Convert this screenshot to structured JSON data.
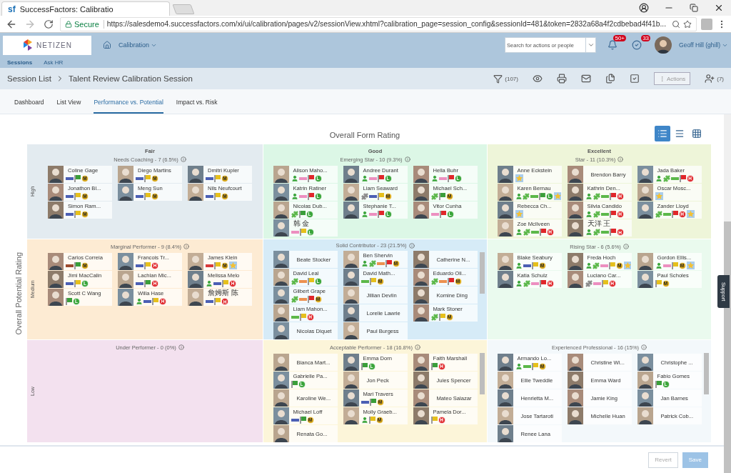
{
  "browser": {
    "tab_icon": "sf",
    "tab_title": "SuccessFactors: Calibratio",
    "secure_label": "Secure",
    "url": "https://salesdemo4.successfactors.com/xi/ui/calibration/pages/v2/sessionView.xhtml?calibration_page=session_config&sessionId=481&token=2832a68a4f2cdbebad4f41b..."
  },
  "header": {
    "logo": "NETIZEN",
    "nav_menu": "Calibration",
    "search": {
      "placeholder": "Search for actions or people"
    },
    "notification_count": "50+",
    "todo_count": "33",
    "user": "Geoff Hill (ghill)"
  },
  "subnav": [
    "Sessions",
    "Ask HR"
  ],
  "session_bar": {
    "breadcrumb": [
      "Session List",
      "Talent Review Calibration Session"
    ],
    "filter_count": "(107)",
    "actions": "Actions",
    "participant_count": "(7)"
  },
  "tabs": [
    {
      "label": "Dashboard",
      "selected": false
    },
    {
      "label": "List View",
      "selected": false
    },
    {
      "label": "Performance vs. Potential",
      "selected": true
    },
    {
      "label": "Impact vs. Risk",
      "selected": false
    }
  ],
  "matrix": {
    "title": "Overall Form Rating",
    "y_axis": "Overall Potential Rating",
    "views": [
      {
        "kind": "detail",
        "selected": true
      },
      {
        "kind": "list",
        "selected": false
      },
      {
        "kind": "grid",
        "selected": false
      }
    ],
    "rows": [
      {
        "label": "High",
        "cells": [
          {
            "heading": "Fair",
            "title": "Needs Coaching - 7 (6.5%)",
            "color": "#e3ebf0",
            "people": [
              {
                "name": "Coline Gage",
                "badges": [
                  {
                    "kind": "bar",
                    "color": "#4b5fb4"
                  },
                  {
                    "kind": "flag",
                    "color": "#3a9e3a"
                  },
                  {
                    "kind": "rating",
                    "text": "M",
                    "color": "#d9a91a"
                  }
                ]
              },
              {
                "name": "Diego Martins",
                "badges": [
                  {
                    "kind": "bar",
                    "color": "#4b5fb4"
                  },
                  {
                    "kind": "flag",
                    "color": "#e6c01c"
                  },
                  {
                    "kind": "rating",
                    "text": "M",
                    "color": "#d9a91a"
                  }
                ]
              },
              {
                "name": "Dmitri Kupler",
                "badges": [
                  {
                    "kind": "bar",
                    "color": "#4b5fb4"
                  },
                  {
                    "kind": "flag",
                    "color": "#e6c01c"
                  },
                  {
                    "kind": "rating",
                    "text": "M",
                    "color": "#d9a91a"
                  }
                ]
              },
              {
                "name": "Jonathon Bl...",
                "badges": [
                  {
                    "kind": "bar",
                    "color": "#4b5fb4"
                  },
                  {
                    "kind": "flag",
                    "color": "#e6c01c"
                  },
                  {
                    "kind": "rating",
                    "text": "M",
                    "color": "#d9a91a"
                  }
                ]
              },
              {
                "name": "Meng Sun",
                "badges": [
                  {
                    "kind": "bar",
                    "color": "#4b5fb4"
                  },
                  {
                    "kind": "flag",
                    "color": "#e6c01c"
                  },
                  {
                    "kind": "rating",
                    "text": "M",
                    "color": "#d9a91a"
                  }
                ]
              },
              {
                "name": "Nils Neufcourt",
                "badges": [
                  {
                    "kind": "bar",
                    "color": "#4b5fb4"
                  },
                  {
                    "kind": "flag",
                    "color": "#e6c01c"
                  },
                  {
                    "kind": "rating",
                    "text": "M",
                    "color": "#d9a91a"
                  }
                ]
              },
              {
                "name": "Simon Ram...",
                "badges": [
                  {
                    "kind": "bar",
                    "color": "#4b5fb4"
                  },
                  {
                    "kind": "flag",
                    "color": "#e6c01c"
                  },
                  {
                    "kind": "rating",
                    "text": "M",
                    "color": "#d9a91a"
                  }
                ]
              }
            ]
          },
          {
            "heading": "Good",
            "title": "Emerging Star - 10 (9.3%)",
            "color": "#dcf7e6",
            "people": [
              {
                "name": "Alison Maho...",
                "badges": [
                  {
                    "kind": "person"
                  },
                  {
                    "kind": "bar",
                    "color": "#ec8fc0"
                  },
                  {
                    "kind": "flag",
                    "color": "#e0262a"
                  },
                  {
                    "kind": "rating",
                    "text": "L",
                    "color": "#3aa53a"
                  }
                ]
              },
              {
                "name": "Andree Durant",
                "badges": [
                  {
                    "kind": "person"
                  },
                  {
                    "kind": "bar",
                    "color": "#ec8fc0"
                  },
                  {
                    "kind": "flag",
                    "color": "#e0262a"
                  },
                  {
                    "kind": "rating",
                    "text": "L",
                    "color": "#3aa53a"
                  }
                ]
              },
              {
                "name": "Hella Buhr",
                "badges": [
                  {
                    "kind": "person"
                  },
                  {
                    "kind": "bar",
                    "color": "#ec8fc0"
                  },
                  {
                    "kind": "flag",
                    "color": "#e0262a"
                  },
                  {
                    "kind": "rating",
                    "text": "L",
                    "color": "#3aa53a"
                  }
                ]
              },
              {
                "name": "Katrin Ratiner",
                "badges": [
                  {
                    "kind": "person"
                  },
                  {
                    "kind": "bar",
                    "color": "#ec8fc0"
                  },
                  {
                    "kind": "flag",
                    "color": "#e0262a"
                  },
                  {
                    "kind": "rating",
                    "text": "L",
                    "color": "#3aa53a"
                  }
                ]
              },
              {
                "name": "Liam Seaward",
                "badges": [
                  {
                    "kind": "puzzle",
                    "color": "#8c8c8c"
                  },
                  {
                    "kind": "bar",
                    "color": "#4b5fb4"
                  },
                  {
                    "kind": "flag",
                    "color": "#e6c01c"
                  },
                  {
                    "kind": "rating",
                    "text": "M",
                    "color": "#d9a91a"
                  }
                ]
              },
              {
                "name": "Michael Sch...",
                "badges": [
                  {
                    "kind": "puzzle",
                    "color": "#5cb84a"
                  },
                  {
                    "kind": "flag",
                    "color": "#3a9e3a"
                  },
                  {
                    "kind": "rating",
                    "text": "M",
                    "color": "#d9a91a"
                  }
                ]
              },
              {
                "name": "Nicolas Dub...",
                "badges": [
                  {
                    "kind": "puzzle",
                    "color": "#5cb84a"
                  },
                  {
                    "kind": "flag",
                    "color": "#3a9e3a"
                  },
                  {
                    "kind": "rating",
                    "text": "L",
                    "color": "#3aa53a"
                  }
                ]
              },
              {
                "name": "Stephanie T...",
                "badges": [
                  {
                    "kind": "person"
                  },
                  {
                    "kind": "bar",
                    "color": "#ec8fc0"
                  },
                  {
                    "kind": "flag",
                    "color": "#e0262a"
                  },
                  {
                    "kind": "rating",
                    "text": "L",
                    "color": "#3aa53a"
                  }
                ]
              },
              {
                "name": "Vitor Cunha",
                "badges": [
                  {
                    "kind": "bar",
                    "color": "#ec8fc0"
                  },
                  {
                    "kind": "flag",
                    "color": "#e0262a"
                  },
                  {
                    "kind": "rating",
                    "text": "L",
                    "color": "#3aa53a"
                  }
                ]
              },
              {
                "name": "韩 金",
                "badges": [
                  {
                    "kind": "bar",
                    "color": "#ec8fc0"
                  },
                  {
                    "kind": "flag",
                    "color": "#e6c01c"
                  },
                  {
                    "kind": "rating",
                    "text": "L",
                    "color": "#3aa53a"
                  }
                ]
              }
            ]
          },
          {
            "heading": "Excellent",
            "title": "Star - 11 (10.3%)",
            "color": "#eef5d9",
            "people": [
              {
                "name": "Anne Eckstein",
                "badges": [
                  {
                    "kind": "star"
                  }
                ]
              },
              {
                "name": "Brendon Barry"
              },
              {
                "name": "Jada Baker",
                "badges": [
                  {
                    "kind": "person"
                  },
                  {
                    "kind": "puzzle",
                    "color": "#5cb84a"
                  },
                  {
                    "kind": "bar",
                    "color": "#5cb84a"
                  },
                  {
                    "kind": "flag",
                    "color": "#e0262a"
                  },
                  {
                    "kind": "rating",
                    "text": "H",
                    "color": "#e0262a"
                  }
                ]
              },
              {
                "name": "Karen Bernau",
                "badges": [
                  {
                    "kind": "person"
                  },
                  {
                    "kind": "puzzle",
                    "color": "#5cb84a"
                  },
                  {
                    "kind": "bar",
                    "color": "#5cb84a"
                  },
                  {
                    "kind": "flag",
                    "color": "#3a9e3a"
                  },
                  {
                    "kind": "rating",
                    "text": "L",
                    "color": "#3aa53a"
                  },
                  {
                    "kind": "star"
                  }
                ]
              },
              {
                "name": "Kathrin Den...",
                "badges": [
                  {
                    "kind": "person"
                  },
                  {
                    "kind": "puzzle",
                    "color": "#5cb84a"
                  },
                  {
                    "kind": "bar",
                    "color": "#5cb84a"
                  },
                  {
                    "kind": "flag",
                    "color": "#e0262a"
                  },
                  {
                    "kind": "rating",
                    "text": "H",
                    "color": "#e0262a"
                  }
                ]
              },
              {
                "name": "Oscar Mosc...",
                "badges": [
                  {
                    "kind": "star"
                  }
                ]
              },
              {
                "name": "Rebecca Ch...",
                "badges": [
                  {
                    "kind": "star"
                  }
                ]
              },
              {
                "name": "Silvia Candido",
                "badges": [
                  {
                    "kind": "person"
                  },
                  {
                    "kind": "puzzle",
                    "color": "#5cb84a"
                  },
                  {
                    "kind": "bar",
                    "color": "#5cb84a"
                  },
                  {
                    "kind": "flag",
                    "color": "#e0262a"
                  },
                  {
                    "kind": "rating",
                    "text": "H",
                    "color": "#e0262a"
                  }
                ]
              },
              {
                "name": "Zander Lloyd",
                "badges": [
                  {
                    "kind": "puzzle",
                    "color": "#5cb84a"
                  },
                  {
                    "kind": "bar",
                    "color": "#5cb84a"
                  },
                  {
                    "kind": "flag",
                    "color": "#e0262a"
                  },
                  {
                    "kind": "rating",
                    "text": "H",
                    "color": "#e0262a"
                  },
                  {
                    "kind": "star"
                  }
                ]
              },
              {
                "name": "Zoe McIlveen",
                "badges": [
                  {
                    "kind": "person"
                  },
                  {
                    "kind": "puzzle",
                    "color": "#5cb84a"
                  },
                  {
                    "kind": "bar",
                    "color": "#5cb84a"
                  },
                  {
                    "kind": "flag",
                    "color": "#e0262a"
                  },
                  {
                    "kind": "rating",
                    "text": "H",
                    "color": "#e0262a"
                  }
                ]
              },
              {
                "name": "天洋 王",
                "badges": [
                  {
                    "kind": "person"
                  },
                  {
                    "kind": "puzzle",
                    "color": "#5cb84a"
                  },
                  {
                    "kind": "bar",
                    "color": "#5cb84a"
                  },
                  {
                    "kind": "flag",
                    "color": "#e0262a"
                  },
                  {
                    "kind": "rating",
                    "text": "H",
                    "color": "#e0262a"
                  }
                ]
              }
            ]
          }
        ]
      },
      {
        "label": "Medium",
        "cells": [
          {
            "title": "Marginal Performer - 9 (8.4%)",
            "color": "#fdebd3",
            "people": [
              {
                "name": "Carlos Correia",
                "badges": [
                  {
                    "kind": "bar",
                    "color": "#9c4a2e"
                  },
                  {
                    "kind": "flag",
                    "color": "#3a9e3a"
                  },
                  {
                    "kind": "rating",
                    "text": "M",
                    "color": "#d9a91a"
                  }
                ]
              },
              {
                "name": "Francois Tr...",
                "badges": [
                  {
                    "kind": "bar",
                    "color": "#4b5fb4"
                  },
                  {
                    "kind": "flag",
                    "color": "#e6c01c"
                  },
                  {
                    "kind": "rating",
                    "text": "H",
                    "color": "#e0262a"
                  }
                ]
              },
              {
                "name": "James Klein",
                "badges": [
                  {
                    "kind": "bar",
                    "color": "#d73a3a"
                  },
                  {
                    "kind": "flag",
                    "color": "#e6c01c"
                  },
                  {
                    "kind": "rating",
                    "text": "M",
                    "color": "#d9a91a"
                  },
                  {
                    "kind": "star"
                  }
                ]
              },
              {
                "name": "Jimi MacCalin",
                "badges": [
                  {
                    "kind": "bar",
                    "color": "#4b5fb4"
                  },
                  {
                    "kind": "flag",
                    "color": "#e6c01c"
                  },
                  {
                    "kind": "rating",
                    "text": "L",
                    "color": "#3aa53a"
                  }
                ]
              },
              {
                "name": "Lachlan Mic...",
                "badges": [
                  {
                    "kind": "bar",
                    "color": "#4b5fb4"
                  },
                  {
                    "kind": "flag",
                    "color": "#3a9e3a"
                  },
                  {
                    "kind": "rating",
                    "text": "H",
                    "color": "#e0262a"
                  }
                ]
              },
              {
                "name": "Melissa Melo",
                "badges": [
                  {
                    "kind": "person"
                  },
                  {
                    "kind": "bar",
                    "color": "#4b5fb4"
                  },
                  {
                    "kind": "flag",
                    "color": "#e6c01c"
                  },
                  {
                    "kind": "rating",
                    "text": "H",
                    "color": "#e0262a"
                  }
                ]
              },
              {
                "name": "Scott C Wang",
                "badges": [
                  {
                    "kind": "flag",
                    "color": "#3a9e3a"
                  },
                  {
                    "kind": "rating",
                    "text": "L",
                    "color": "#3aa53a"
                  }
                ]
              },
              {
                "name": "Willa Hase",
                "badges": [
                  {
                    "kind": "person"
                  },
                  {
                    "kind": "bar",
                    "color": "#4b5fb4"
                  },
                  {
                    "kind": "flag",
                    "color": "#e6c01c"
                  },
                  {
                    "kind": "rating",
                    "text": "H",
                    "color": "#e0262a"
                  }
                ]
              },
              {
                "name": "詹姆斯 陈",
                "badges": [
                  {
                    "kind": "bar",
                    "color": "#4b5fb4"
                  },
                  {
                    "kind": "flag",
                    "color": "#e6c01c"
                  },
                  {
                    "kind": "rating",
                    "text": "H",
                    "color": "#e0262a"
                  }
                ]
              }
            ]
          },
          {
            "title": "Solid Contributor - 23 (21.5%)",
            "color": "#d6ebf7",
            "people": [
              {
                "name": "Beate Stocker"
              },
              {
                "name": "Ben Shervin",
                "badges": [
                  {
                    "kind": "person"
                  },
                  {
                    "kind": "puzzle",
                    "color": "#5cb84a"
                  },
                  {
                    "kind": "bar",
                    "color": "#ec9150"
                  },
                  {
                    "kind": "flag",
                    "color": "#e0262a"
                  },
                  {
                    "kind": "rating",
                    "text": "M",
                    "color": "#d9a91a"
                  }
                ]
              },
              {
                "name": "Catherine N..."
              },
              {
                "name": "David Leal",
                "badges": [
                  {
                    "kind": "puzzle",
                    "color": "#5cb84a"
                  },
                  {
                    "kind": "bar",
                    "color": "#ec9150"
                  },
                  {
                    "kind": "flag",
                    "color": "#e6c01c"
                  },
                  {
                    "kind": "rating",
                    "text": "L",
                    "color": "#3aa53a"
                  }
                ]
              },
              {
                "name": "David Math...",
                "badges": [
                  {
                    "kind": "bar",
                    "color": "#5cb84a"
                  },
                  {
                    "kind": "flag",
                    "color": "#e6c01c"
                  },
                  {
                    "kind": "rating",
                    "text": "M",
                    "color": "#d9a91a"
                  }
                ]
              },
              {
                "name": "Eduardo Oli...",
                "badges": [
                  {
                    "kind": "puzzle",
                    "color": "#5cb84a"
                  },
                  {
                    "kind": "bar",
                    "color": "#ec9150"
                  },
                  {
                    "kind": "flag",
                    "color": "#e0262a"
                  },
                  {
                    "kind": "rating",
                    "text": "M",
                    "color": "#d9a91a"
                  }
                ]
              },
              {
                "name": "Gilbert Grape",
                "badges": [
                  {
                    "kind": "puzzle",
                    "color": "#5cb84a"
                  },
                  {
                    "kind": "bar",
                    "color": "#ec9150"
                  },
                  {
                    "kind": "flag",
                    "color": "#e0262a"
                  },
                  {
                    "kind": "rating",
                    "text": "M",
                    "color": "#d9a91a"
                  }
                ]
              },
              {
                "name": "Jillian Devlin"
              },
              {
                "name": "Komine Ding"
              },
              {
                "name": "Liam Mahon...",
                "badges": [
                  {
                    "kind": "bar",
                    "color": "#5cb84a"
                  },
                  {
                    "kind": "flag",
                    "color": "#e6c01c"
                  },
                  {
                    "kind": "rating",
                    "text": "H",
                    "color": "#e0262a"
                  }
                ]
              },
              {
                "name": "Lorelie Lawrie"
              },
              {
                "name": "Mark Stoner",
                "badges": [
                  {
                    "kind": "puzzle",
                    "color": "#5cb84a"
                  },
                  {
                    "kind": "flag",
                    "color": "#e6c01c"
                  },
                  {
                    "kind": "rating",
                    "text": "M",
                    "color": "#d9a91a"
                  }
                ]
              },
              {
                "name": "Nicolas Diquet"
              },
              {
                "name": "Paul Burgess"
              }
            ]
          },
          {
            "title": "Rising Star - 6 (5.6%)",
            "color": "#eafaee",
            "people": [
              {
                "name": "Blake Seabury",
                "badges": [
                  {
                    "kind": "person"
                  },
                  {
                    "kind": "bar",
                    "color": "#4b5fb4"
                  },
                  {
                    "kind": "flag",
                    "color": "#e6c01c"
                  },
                  {
                    "kind": "rating",
                    "text": "M",
                    "color": "#d9a91a"
                  }
                ]
              },
              {
                "name": "Freda Hoch",
                "badges": [
                  {
                    "kind": "person"
                  },
                  {
                    "kind": "puzzle",
                    "color": "#5cb84a"
                  },
                  {
                    "kind": "bar",
                    "color": "#ec8fc0"
                  },
                  {
                    "kind": "flag",
                    "color": "#e6c01c"
                  },
                  {
                    "kind": "rating",
                    "text": "M",
                    "color": "#d9a91a"
                  },
                  {
                    "kind": "star"
                  }
                ]
              },
              {
                "name": "Gordon Ellis...",
                "badges": [
                  {
                    "kind": "person"
                  },
                  {
                    "kind": "bar",
                    "color": "#ec8fc0"
                  },
                  {
                    "kind": "flag",
                    "color": "#e6c01c"
                  },
                  {
                    "kind": "rating",
                    "text": "M",
                    "color": "#d9a91a"
                  },
                  {
                    "kind": "star"
                  }
                ]
              },
              {
                "name": "Katia Schulz",
                "badges": [
                  {
                    "kind": "person"
                  },
                  {
                    "kind": "puzzle",
                    "color": "#5cb84a"
                  },
                  {
                    "kind": "bar",
                    "color": "#ec8fc0"
                  },
                  {
                    "kind": "flag",
                    "color": "#e0262a"
                  },
                  {
                    "kind": "rating",
                    "text": "H",
                    "color": "#e0262a"
                  }
                ]
              },
              {
                "name": "Luciano Car...",
                "badges": [
                  {
                    "kind": "puzzle",
                    "color": "#8c8c8c"
                  },
                  {
                    "kind": "bar",
                    "color": "#ec8fc0"
                  },
                  {
                    "kind": "flag",
                    "color": "#e6c01c"
                  },
                  {
                    "kind": "rating",
                    "text": "H",
                    "color": "#e0262a"
                  }
                ]
              },
              {
                "name": "Paul Scholes",
                "badges": [
                  {
                    "kind": "flag",
                    "color": "#e6c01c"
                  },
                  {
                    "kind": "rating",
                    "text": "M",
                    "color": "#d9a91a"
                  }
                ]
              }
            ]
          }
        ]
      },
      {
        "label": "Low",
        "cells": [
          {
            "title": "Under Performer - 0 (0%)",
            "color": "#f3e1ef"
          },
          {
            "title": "Acceptable Performer - 18 (16.8%)",
            "color": "#fcf5d9",
            "people": [
              {
                "name": "Bianca Mart..."
              },
              {
                "name": "Emma Dorn",
                "badges": [
                  {
                    "kind": "flag",
                    "color": "#3a9e3a"
                  },
                  {
                    "kind": "rating",
                    "text": "L",
                    "color": "#3aa53a"
                  }
                ]
              },
              {
                "name": "Faith Marshall",
                "badges": [
                  {
                    "kind": "flag",
                    "color": "#3a9e3a"
                  },
                  {
                    "kind": "rating",
                    "text": "H",
                    "color": "#e0262a"
                  }
                ]
              },
              {
                "name": "Gabrielle Pa...",
                "badges": [
                  {
                    "kind": "flag",
                    "color": "#3a9e3a"
                  },
                  {
                    "kind": "rating",
                    "text": "L",
                    "color": "#3aa53a"
                  }
                ]
              },
              {
                "name": "Jon Peck"
              },
              {
                "name": "Jules Spencer"
              },
              {
                "name": "Karoline We..."
              },
              {
                "name": "Mari Travers",
                "badges": [
                  {
                    "kind": "bar",
                    "color": "#4b5fb4"
                  },
                  {
                    "kind": "flag",
                    "color": "#3a9e3a"
                  },
                  {
                    "kind": "rating",
                    "text": "M",
                    "color": "#d9a91a"
                  }
                ]
              },
              {
                "name": "Mateo Salazar"
              },
              {
                "name": "Michael Loff",
                "badges": [
                  {
                    "kind": "bar",
                    "color": "#4b5fb4"
                  },
                  {
                    "kind": "flag",
                    "color": "#3a9e3a"
                  },
                  {
                    "kind": "rating",
                    "text": "M",
                    "color": "#d9a91a"
                  }
                ]
              },
              {
                "name": "Molly Graeb...",
                "badges": [
                  {
                    "kind": "person"
                  },
                  {
                    "kind": "flag",
                    "color": "#e6c01c"
                  },
                  {
                    "kind": "rating",
                    "text": "M",
                    "color": "#d9a91a"
                  }
                ]
              },
              {
                "name": "Pamela Dor...",
                "badges": [
                  {
                    "kind": "flag",
                    "color": "#e6c01c"
                  },
                  {
                    "kind": "rating",
                    "text": "H",
                    "color": "#e0262a"
                  }
                ]
              },
              {
                "name": "Renata Go..."
              }
            ]
          },
          {
            "title": "Experienced Professional - 16 (15%)",
            "color": "#f3f8fb",
            "people": [
              {
                "name": "Armando Lo...",
                "badges": [
                  {
                    "kind": "person"
                  },
                  {
                    "kind": "bar",
                    "color": "#5cb84a"
                  },
                  {
                    "kind": "flag",
                    "color": "#e6c01c"
                  },
                  {
                    "kind": "rating",
                    "text": "M",
                    "color": "#d9a91a"
                  }
                ]
              },
              {
                "name": "Christine Wi..."
              },
              {
                "name": "Christophe ..."
              },
              {
                "name": "Ellie Tweddle"
              },
              {
                "name": "Emma Ward"
              },
              {
                "name": "Fabio Gomes",
                "badges": [
                  {
                    "kind": "flag",
                    "color": "#3a9e3a"
                  },
                  {
                    "kind": "rating",
                    "text": "L",
                    "color": "#3aa53a"
                  }
                ]
              },
              {
                "name": "Henrietta M..."
              },
              {
                "name": "Jamie King"
              },
              {
                "name": "Jan Barnes"
              },
              {
                "name": "Jose Tartaroti"
              },
              {
                "name": "Michelle Huan"
              },
              {
                "name": "Patrick Cob..."
              },
              {
                "name": "Renee Lana"
              }
            ]
          }
        ]
      }
    ]
  },
  "footer": {
    "buttons": [
      {
        "label": "Revert",
        "kind": "secondary"
      },
      {
        "label": "Save",
        "kind": "primary"
      }
    ]
  },
  "support": "Support"
}
